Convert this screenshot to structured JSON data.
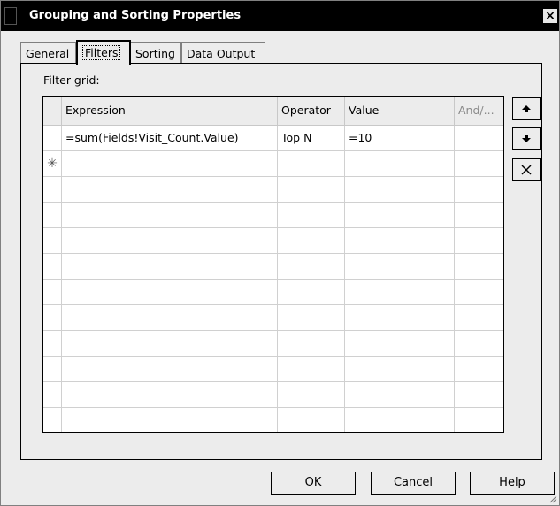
{
  "window": {
    "title": "Grouping and Sorting Properties",
    "close_glyph": "×"
  },
  "tabs": [
    {
      "label": "General",
      "active": false
    },
    {
      "label": "Filters",
      "active": true
    },
    {
      "label": "Sorting",
      "active": false
    },
    {
      "label": "Data Output",
      "active": false
    }
  ],
  "filter": {
    "label": "Filter grid:",
    "columns": [
      {
        "label": "Expression",
        "enabled": true
      },
      {
        "label": "Operator",
        "enabled": true
      },
      {
        "label": "Value",
        "enabled": true
      },
      {
        "label": "And/...",
        "enabled": false
      }
    ],
    "rows": [
      [
        "=sum(Fields!Visit_Count.Value)",
        "Top N",
        "=10",
        ""
      ]
    ],
    "new_row_marker": "✳"
  },
  "side_buttons": [
    {
      "name": "move-up",
      "icon": "arrow-up-icon"
    },
    {
      "name": "move-down",
      "icon": "arrow-down-icon"
    },
    {
      "name": "delete",
      "icon": "delete-x-icon"
    }
  ],
  "buttons": {
    "ok": "OK",
    "cancel": "Cancel",
    "help": "Help"
  }
}
